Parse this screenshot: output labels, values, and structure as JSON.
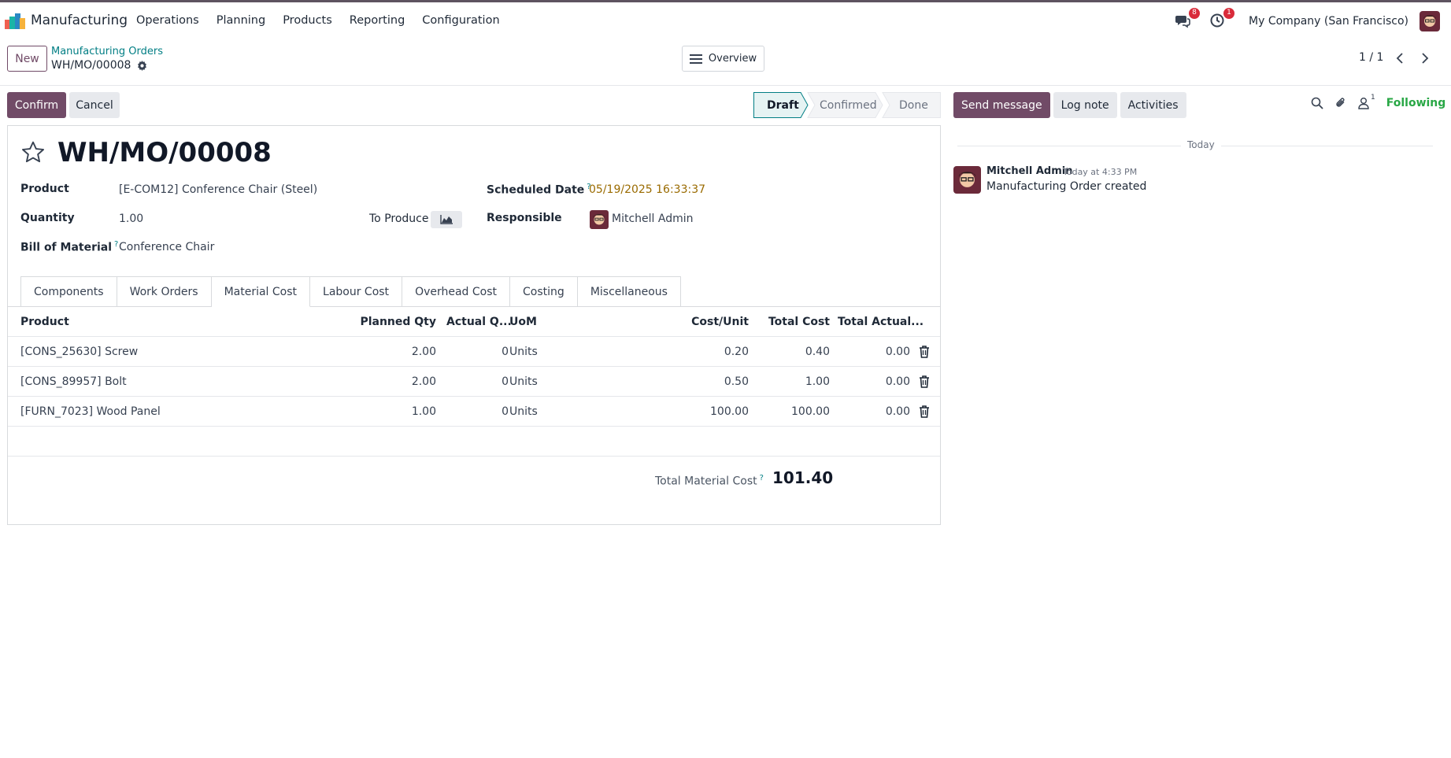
{
  "navbar": {
    "app_name": "Manufacturing",
    "menu": [
      "Operations",
      "Planning",
      "Products",
      "Reporting",
      "Configuration"
    ],
    "messages_badge": "8",
    "activities_badge": "1",
    "company": "My Company (San Francisco)"
  },
  "control": {
    "new_label": "New",
    "breadcrumb_parent": "Manufacturing Orders",
    "record_name": "WH/MO/00008",
    "overview_label": "Overview",
    "pager": "1 / 1"
  },
  "status": {
    "confirm_label": "Confirm",
    "cancel_label": "Cancel",
    "stages": [
      "Draft",
      "Confirmed",
      "Done"
    ],
    "active_stage": "Draft"
  },
  "form": {
    "title": "WH/MO/00008",
    "product_label": "Product",
    "product_value": "[E-COM12] Conference Chair (Steel)",
    "quantity_label": "Quantity",
    "quantity_value": "1.00",
    "to_produce_label": "To Produce",
    "bom_label": "Bill of Material",
    "bom_value": "Conference Chair",
    "scheduled_label": "Scheduled Date",
    "scheduled_value": "05/19/2025 16:33:37",
    "responsible_label": "Responsible",
    "responsible_value": "Mitchell Admin",
    "help_mark": "?"
  },
  "tabs": [
    "Components",
    "Work Orders",
    "Material Cost",
    "Labour Cost",
    "Overhead Cost",
    "Costing",
    "Miscellaneous"
  ],
  "active_tab": "Material Cost",
  "table": {
    "headers": [
      "Product",
      "Planned Qty",
      "Actual Q...",
      "UoM",
      "Cost/Unit",
      "Total Cost",
      "Total Actual..."
    ],
    "rows": [
      [
        "[CONS_25630] Screw",
        "2.00",
        "0",
        "Units",
        "0.20",
        "0.40",
        "0.00"
      ],
      [
        "[CONS_89957] Bolt",
        "2.00",
        "0",
        "Units",
        "0.50",
        "1.00",
        "0.00"
      ],
      [
        "[FURN_7023] Wood Panel",
        "1.00",
        "0",
        "Units",
        "100.00",
        "100.00",
        "0.00"
      ]
    ]
  },
  "totals": {
    "label": "Total Material Cost",
    "value": "101.40"
  },
  "chatter": {
    "send_message": "Send message",
    "log_note": "Log note",
    "activities": "Activities",
    "followers_count": "1",
    "following": "Following",
    "date_separator": "Today",
    "message": {
      "author": "Mitchell Admin",
      "time": "Today at 4:33 PM",
      "body": "Manufacturing Order created"
    }
  },
  "colors": {
    "brand": "#714b67",
    "link": "#017e84",
    "scheduled_date": "#9a6b01",
    "following": "#28a745"
  }
}
